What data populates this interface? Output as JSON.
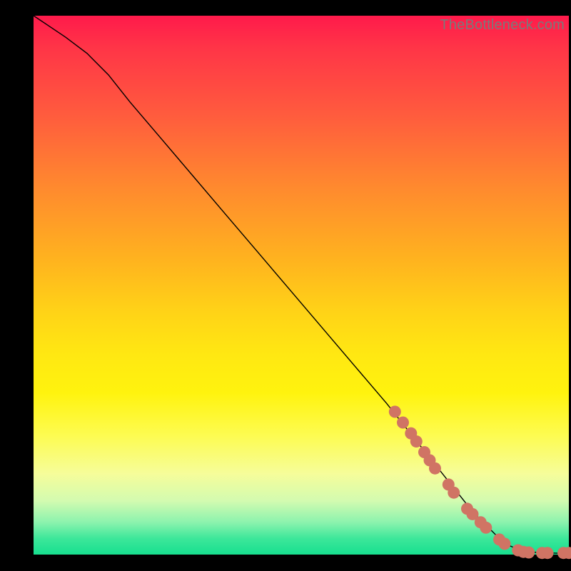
{
  "watermark": "TheBottleneck.com",
  "colors": {
    "dot": "#d07464",
    "curve": "#000000",
    "gradient_top": "#ff1a4b",
    "gradient_bottom": "#17df8f"
  },
  "chart_data": {
    "type": "line",
    "title": "",
    "xlabel": "",
    "ylabel": "",
    "xlim": [
      0,
      100
    ],
    "ylim": [
      0,
      100
    ],
    "grid": false,
    "legend": false,
    "series": [
      {
        "name": "bottleneck-curve",
        "x": [
          0,
          3,
          6,
          10,
          14,
          18,
          24,
          30,
          36,
          42,
          48,
          54,
          60,
          66,
          70,
          74,
          78,
          82,
          85,
          88,
          90,
          92,
          94,
          96,
          98,
          100
        ],
        "y": [
          100,
          98,
          96,
          93,
          89,
          84,
          77,
          70,
          63,
          56,
          49,
          42,
          35,
          28,
          23,
          18,
          13,
          8,
          5,
          2,
          1.2,
          0.6,
          0.4,
          0.3,
          0.25,
          0.25
        ]
      }
    ],
    "points": [
      {
        "name": "p1",
        "x": 67.5,
        "y": 26.5
      },
      {
        "name": "p2",
        "x": 69.0,
        "y": 24.5
      },
      {
        "name": "p3",
        "x": 70.5,
        "y": 22.5
      },
      {
        "name": "p4",
        "x": 71.5,
        "y": 21.0
      },
      {
        "name": "p5",
        "x": 73.0,
        "y": 19.0
      },
      {
        "name": "p6",
        "x": 74.0,
        "y": 17.5
      },
      {
        "name": "p7",
        "x": 75.0,
        "y": 16.0
      },
      {
        "name": "p8",
        "x": 77.5,
        "y": 13.0
      },
      {
        "name": "p9",
        "x": 78.5,
        "y": 11.5
      },
      {
        "name": "p10",
        "x": 81.0,
        "y": 8.5
      },
      {
        "name": "p11",
        "x": 82.0,
        "y": 7.5
      },
      {
        "name": "p12",
        "x": 83.5,
        "y": 6.0
      },
      {
        "name": "p13",
        "x": 84.5,
        "y": 5.0
      },
      {
        "name": "p14",
        "x": 87.0,
        "y": 2.8
      },
      {
        "name": "p15",
        "x": 88.0,
        "y": 2.0
      },
      {
        "name": "p16",
        "x": 90.5,
        "y": 0.8
      },
      {
        "name": "p17",
        "x": 91.5,
        "y": 0.5
      },
      {
        "name": "p18",
        "x": 92.5,
        "y": 0.4
      },
      {
        "name": "p19",
        "x": 95.0,
        "y": 0.3
      },
      {
        "name": "p20",
        "x": 96.0,
        "y": 0.3
      },
      {
        "name": "p21",
        "x": 99.0,
        "y": 0.3
      },
      {
        "name": "p22",
        "x": 100.0,
        "y": 0.3
      }
    ],
    "point_radius_px": 8.5
  }
}
